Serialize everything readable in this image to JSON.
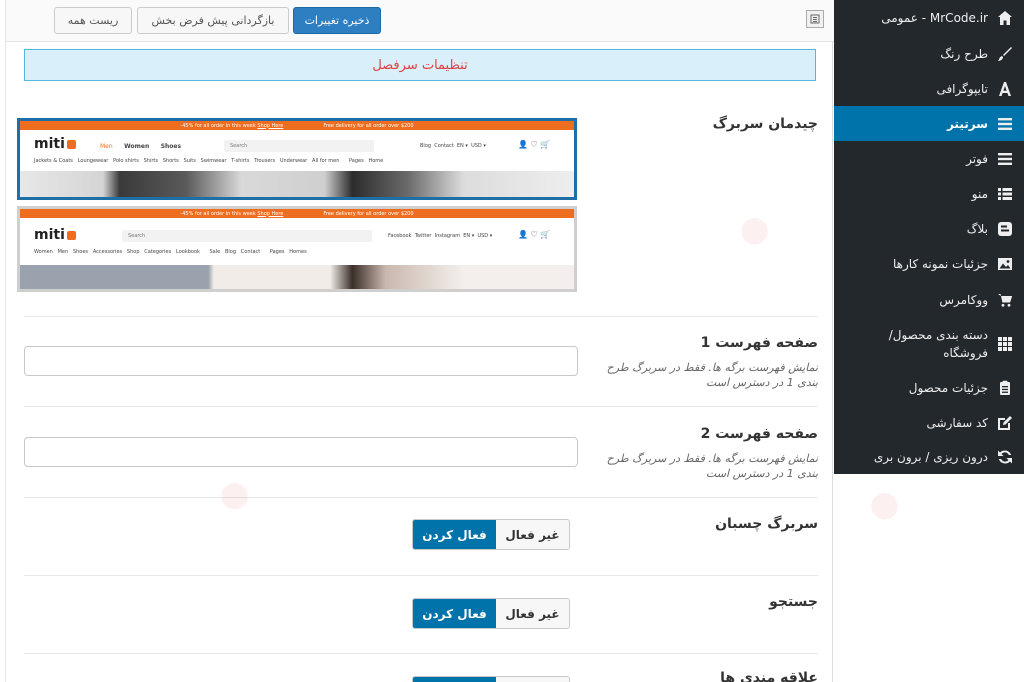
{
  "toolbar": {
    "save_label": "ذخیره تغییرات",
    "reset_section_label": "بازگردانی پیش فرض بخش",
    "reset_all_label": "ریست همه"
  },
  "sidebar": {
    "items": [
      {
        "label": "عمومی - MrCode.ir",
        "icon": "home-icon",
        "active": false
      },
      {
        "label": "طرح رنگ",
        "icon": "brush-icon",
        "active": false
      },
      {
        "label": "تایپوگرافی",
        "icon": "typography-icon",
        "active": false
      },
      {
        "label": "سرتیتر",
        "icon": "menu-lines-icon",
        "active": true
      },
      {
        "label": "فوتر",
        "icon": "menu-lines-icon",
        "active": false
      },
      {
        "label": "منو",
        "icon": "list-icon",
        "active": false
      },
      {
        "label": "بلاگ",
        "icon": "blog-icon",
        "active": false
      },
      {
        "label": "جزئیات نمونه کارها",
        "icon": "image-icon",
        "active": false
      },
      {
        "label": "ووکامرس",
        "icon": "cart-icon",
        "active": false
      },
      {
        "label": "دسته بندی محصول/ فروشگاه",
        "icon": "grid-icon",
        "active": false
      },
      {
        "label": "جزئیات محصول",
        "icon": "clipboard-icon",
        "active": false
      },
      {
        "label": "کد سفارشی",
        "icon": "edit-icon",
        "active": false
      },
      {
        "label": "درون ریزی / برون بری",
        "icon": "sync-icon",
        "active": false
      }
    ]
  },
  "section": {
    "title": "تنظیمات سرفصل"
  },
  "fields": {
    "header_layout": {
      "label": "چیدمان سربرگ"
    },
    "menu_page_1": {
      "label": "صفحه فهرست 1",
      "description": "نمایش فهرست برگه ها. فقط در سربرگ طرح بندی 1 در دسترس است",
      "value": ""
    },
    "menu_page_2": {
      "label": "صفحه فهرست 2",
      "description": "نمایش فهرست برگه ها. فقط در سربرگ طرح بندی 1 در دسترس است",
      "value": ""
    },
    "sticky_header": {
      "label": "سربرگ چسبان",
      "on_label": "فعال کردن",
      "off_label": "غیر فعال",
      "enabled": true
    },
    "search": {
      "label": "جستجو",
      "on_label": "فعال کردن",
      "off_label": "غیر فعال",
      "enabled": true
    },
    "wishlist": {
      "label": "علاقه مندی ها"
    }
  },
  "previews": [
    {
      "selected": true,
      "promo_left": "-45% for all order in this week",
      "promo_link": "Shop Here",
      "promo_right": "Free delivery for all order over $200",
      "logo": "miti",
      "nav": [
        "Men",
        "Women",
        "Shoes"
      ],
      "search": "Search",
      "utility": [
        "Blog",
        "Contact",
        "EN ▾",
        "USD ▾"
      ],
      "categories": [
        "Jackets & Coats",
        "Loungewear",
        "Polo shirts",
        "Shirts",
        "Shorts",
        "Suits",
        "Swimwear",
        "T-shirts",
        "Trousers",
        "Underwear",
        "All for men",
        "Pages",
        "Home"
      ]
    },
    {
      "selected": false,
      "promo_left": "-45% for all order in this week",
      "promo_link": "Shop Here",
      "promo_right": "Free delivery for all order over $200",
      "logo": "miti",
      "search": "Search",
      "utility": [
        "Facebook",
        "Twitter",
        "Instagram",
        "EN ▾",
        "USD ▾"
      ],
      "categories": [
        "Women",
        "Men",
        "Shoes",
        "Accessories",
        "Shop",
        "Categories",
        "Lookbook",
        "Sale",
        "Blog",
        "Contact",
        "Pages",
        "Homes"
      ]
    }
  ],
  "colors": {
    "sidebar_bg": "#23282d",
    "accent": "#0073aa",
    "banner_bg": "#d9f0fb",
    "banner_text": "#e04040",
    "preview_promo": "#ee6d1f"
  }
}
